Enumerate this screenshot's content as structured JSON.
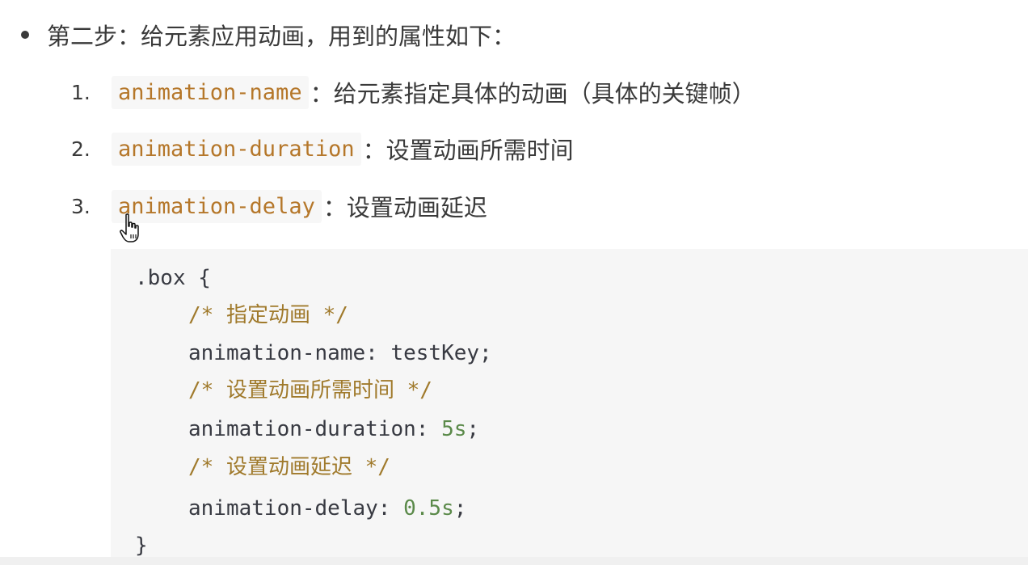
{
  "intro": {
    "text": "第二步：给元素应用动画，用到的属性如下："
  },
  "list": [
    {
      "num": "1.",
      "code": "animation-name",
      "desc": "：给元素指定具体的动画（具体的关键帧）"
    },
    {
      "num": "2.",
      "code": "animation-duration",
      "desc": "：设置动画所需时间"
    },
    {
      "num": "3.",
      "code": "animation-delay",
      "desc": "：设置动画延迟"
    }
  ],
  "code": {
    "line1": ".box {",
    "comment1": "/* 指定动画 */",
    "prop1": "animation-name: ",
    "val1": "testKey",
    "semi1": ";",
    "comment2": "/* 设置动画所需时间 */",
    "prop2": "animation-duration: ",
    "val2": "5s",
    "semi2": ";",
    "comment3": "/* 设置动画延迟 */",
    "prop3": "animation-delay: ",
    "val3": "0.5s",
    "semi3": ";",
    "close": "}"
  },
  "icons": {
    "bullet": "bullet-dot-icon",
    "cursor": "hand-pointer-cursor-icon"
  },
  "colors": {
    "code_chip_text": "#b5772a",
    "code_chip_bg": "#f7f7f7",
    "code_block_bg": "#f6f6f6",
    "comment": "#a07a2c",
    "number": "#5b8a4a"
  }
}
